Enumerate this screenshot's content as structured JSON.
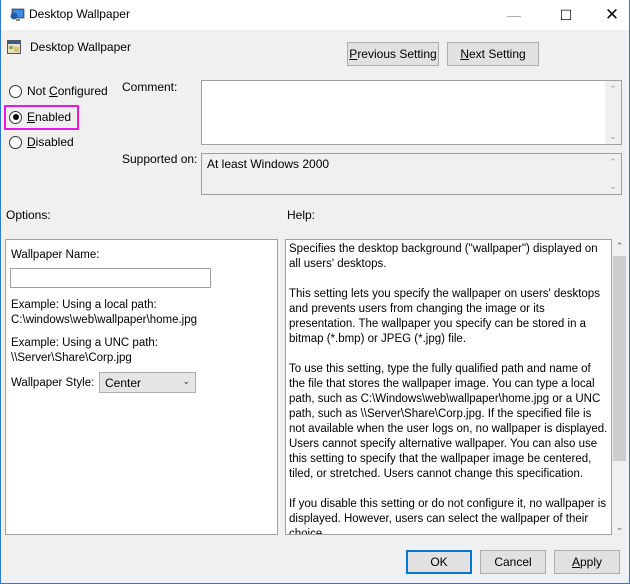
{
  "window": {
    "title": "Desktop Wallpaper",
    "controls": {
      "minimize": "—",
      "maximize": "☐",
      "close": "✕"
    }
  },
  "header": {
    "policy_title": "Desktop Wallpaper",
    "previous_setting": {
      "accel": "P",
      "rest": "revious Setting"
    },
    "next_setting": {
      "accel": "N",
      "rest": "ext Setting"
    }
  },
  "state": {
    "options": [
      {
        "pre": "Not ",
        "accel": "C",
        "rest": "onfigured",
        "checked": false
      },
      {
        "pre": "",
        "accel": "E",
        "rest": "nabled",
        "checked": true
      },
      {
        "pre": "",
        "accel": "D",
        "rest": "isabled",
        "checked": false
      }
    ],
    "highlight_color": "#ea17ea"
  },
  "comment": {
    "label": "Comment:",
    "value": ""
  },
  "supported": {
    "label": "Supported on:",
    "value": "At least Windows 2000"
  },
  "options_label": "Options:",
  "help_label": "Help:",
  "options_panel": {
    "wallpaper_name_label": "Wallpaper Name:",
    "wallpaper_name_value": "",
    "example_local_line1": "Example: Using a local path:",
    "example_local_line2": "C:\\windows\\web\\wallpaper\\home.jpg",
    "example_unc_line1": "Example: Using a UNC path:",
    "example_unc_line2": "\\\\Server\\Share\\Corp.jpg",
    "style_label": "Wallpaper Style:",
    "style_value": "Center"
  },
  "help_panel": {
    "paragraphs": [
      "Specifies the desktop background (\"wallpaper\") displayed on all users' desktops.",
      "This setting lets you specify the wallpaper on users' desktops and prevents users from changing the image or its presentation. The wallpaper you specify can be stored in a bitmap (*.bmp) or JPEG (*.jpg) file.",
      "To use this setting, type the fully qualified path and name of the file that stores the wallpaper image. You can type a local path, such as C:\\Windows\\web\\wallpaper\\home.jpg or a UNC path, such as \\\\Server\\Share\\Corp.jpg. If the specified file is not available when the user logs on, no wallpaper is displayed. Users cannot specify alternative wallpaper. You can also use this setting to specify that the wallpaper image be centered, tiled, or stretched. Users cannot change this specification.",
      "If you disable this setting or do not configure it, no wallpaper is displayed. However, users can select the wallpaper of their choice."
    ]
  },
  "footer": {
    "ok": "OK",
    "cancel": "Cancel",
    "apply": {
      "accel": "A",
      "rest": "pply"
    }
  },
  "icons": {
    "scroll_up": "⌃",
    "scroll_down": "⌄",
    "dropdown": "⌄"
  }
}
